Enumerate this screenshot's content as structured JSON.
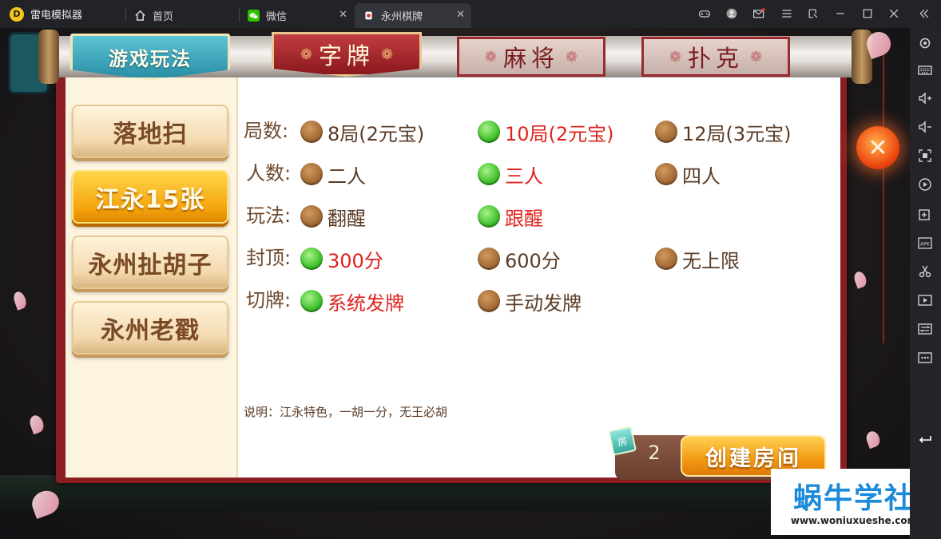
{
  "window": {
    "app_name": "雷电模拟器",
    "tabs": [
      {
        "label": "首页",
        "icon": "home-icon"
      },
      {
        "label": "微信",
        "icon": "wechat-icon"
      },
      {
        "label": "永州棋牌",
        "icon": "game-icon"
      }
    ],
    "controls": [
      "gamepad-icon",
      "account-icon",
      "mail-icon",
      "menu-icon",
      "pin-icon",
      "minimize-icon",
      "maximize-icon",
      "close-icon",
      "collapse-icon"
    ]
  },
  "sidebar_tools": [
    "settings-icon",
    "keyboard-icon",
    "volume-up-icon",
    "volume-down-icon",
    "screenshot-icon",
    "rotate-icon",
    "add-app-icon",
    "apk-icon",
    "scissors-icon",
    "record-icon",
    "sync-icon",
    "more-icon",
    "back-icon"
  ],
  "game": {
    "main_tabs": {
      "rules": "游戏玩法",
      "zipai": "字牌",
      "mahjong": "麻将",
      "poker": "扑克"
    },
    "modes": [
      "落地扫",
      "江永15张",
      "永州扯胡子",
      "永州老戳"
    ],
    "selected_mode": "江永15张",
    "options": {
      "rounds": {
        "label": "局数:",
        "choices": [
          "8局(2元宝)",
          "10局(2元宝)",
          "12局(3元宝)"
        ],
        "selected": 1
      },
      "players": {
        "label": "人数:",
        "choices": [
          "二人",
          "三人",
          "四人"
        ],
        "selected": 1
      },
      "play": {
        "label": "玩法:",
        "choices": [
          "翻醒",
          "跟醒"
        ],
        "selected": 1
      },
      "cap": {
        "label": "封顶:",
        "choices": [
          "300分",
          "600分",
          "无上限"
        ],
        "selected": 0
      },
      "deal": {
        "label": "切牌:",
        "choices": [
          "系统发牌",
          "手动发牌"
        ],
        "selected": 0
      }
    },
    "note": "说明：江永特色，一胡一分，无王必胡",
    "room_tag": "房",
    "room_cost": "2",
    "create_button": "创建房间",
    "close_label": "✕"
  },
  "watermark": {
    "title": "蜗牛学社",
    "url": "www.woniuxueshe.com"
  },
  "colors": {
    "selected_text": "#e0231e",
    "frame_red": "#8a1d22",
    "accent_gold": "#f29a12"
  }
}
